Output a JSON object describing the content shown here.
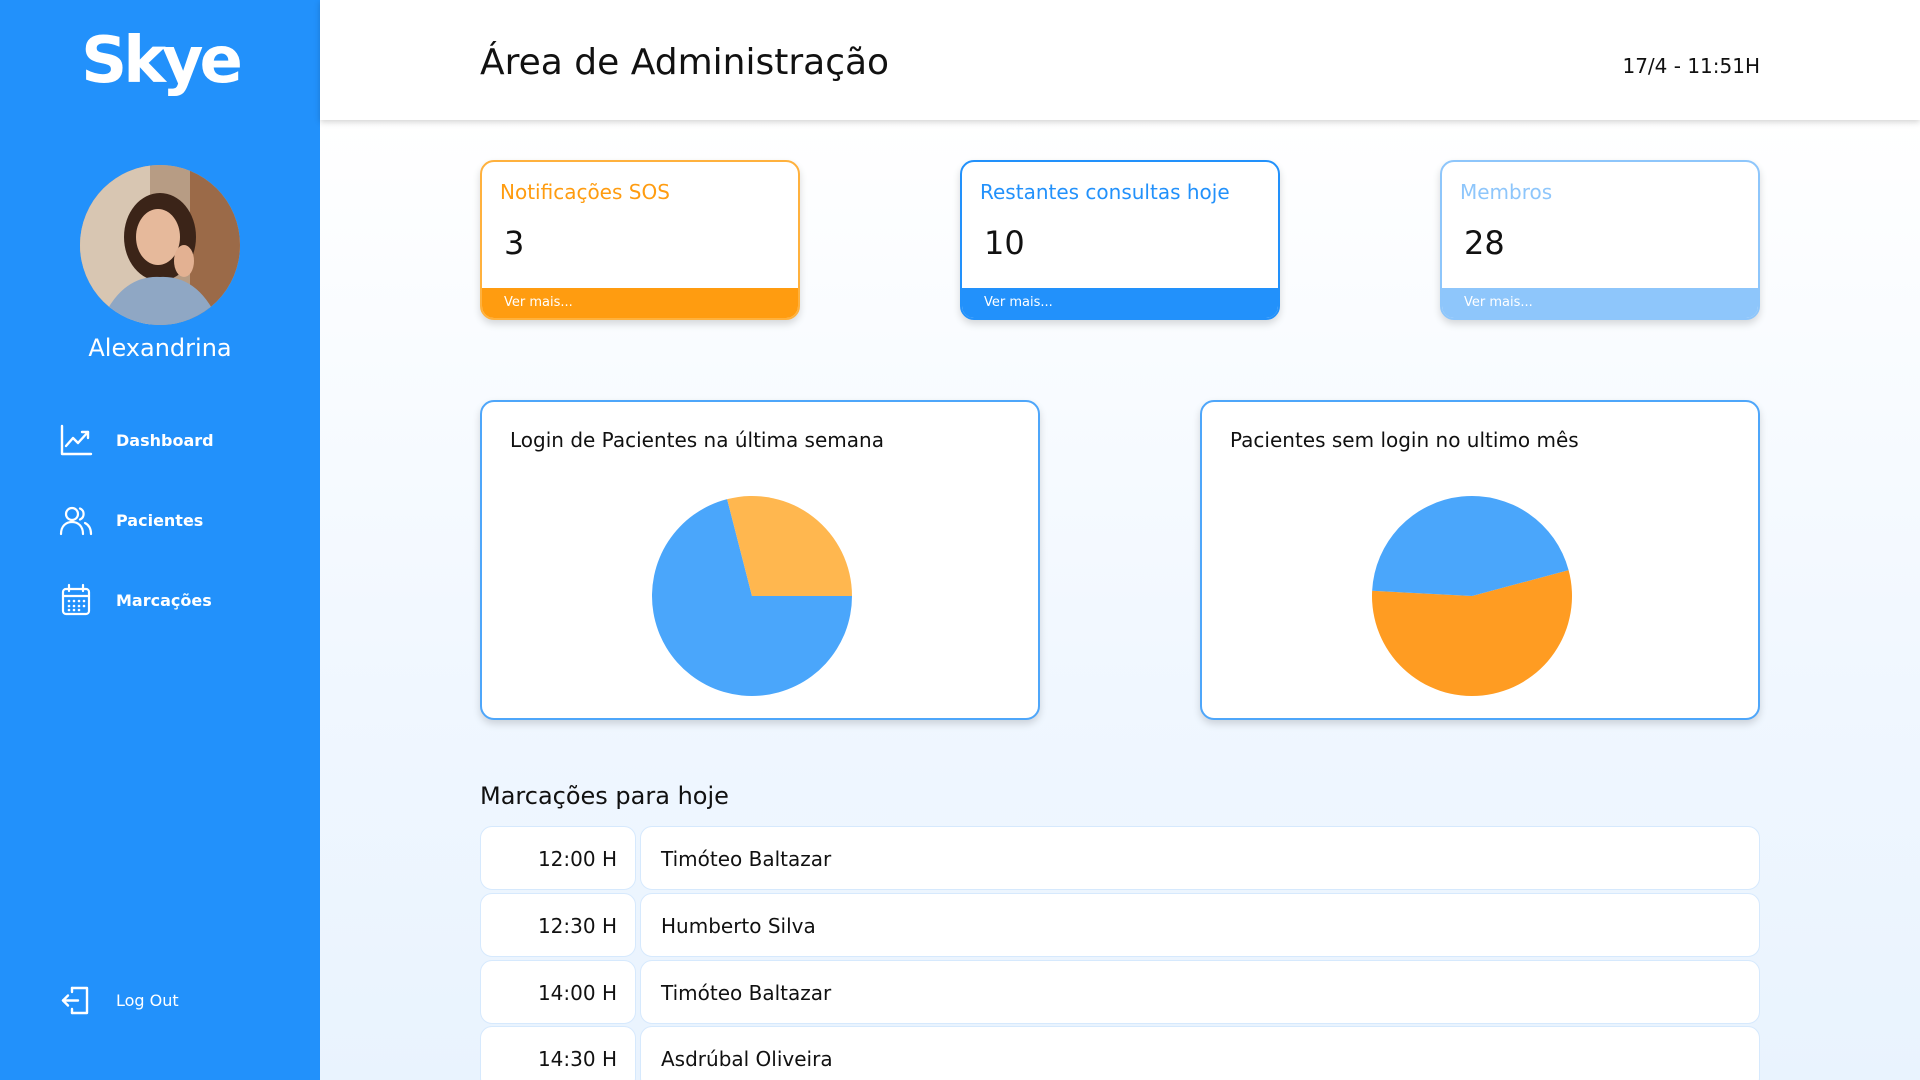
{
  "app": {
    "logo": "Skye"
  },
  "user": {
    "name": "Alexandrina"
  },
  "sidebar": {
    "items": [
      {
        "label": "Dashboard",
        "icon": "chart-line-icon"
      },
      {
        "label": "Pacientes",
        "icon": "users-icon"
      },
      {
        "label": "Marcações",
        "icon": "calendar-icon"
      }
    ],
    "logout": {
      "label": "Log Out",
      "icon": "logout-icon"
    }
  },
  "header": {
    "title": "Área de Administração",
    "datetime": "17/4 - 11:51H"
  },
  "stats": [
    {
      "label": "Notificações SOS",
      "value": "3",
      "more": "Ver mais...",
      "color": "#ff9c10"
    },
    {
      "label": "Restantes consultas hoje",
      "value": "10",
      "more": "Ver mais...",
      "color": "#2291fb"
    },
    {
      "label": "Membros",
      "value": "28",
      "more": "Ver mais...",
      "color": "#8ec6fb"
    }
  ],
  "colors": {
    "sidebar": "#2291fb",
    "orange": "#ff9c10",
    "light_orange": "#ffb74f",
    "pie_blue": "#4aa6fb"
  },
  "chart_data": [
    {
      "type": "pie",
      "title": "Login de Pacientes na última semana",
      "slices": [
        {
          "value": 71,
          "color": "#4aa6fb"
        },
        {
          "value": 29,
          "color": "#ffb74f"
        }
      ]
    },
    {
      "type": "pie",
      "title": "Pacientes sem login no ultimo mês",
      "slices": [
        {
          "value": 55,
          "color": "#ff9c22"
        },
        {
          "value": 45,
          "color": "#4aa6fb"
        }
      ]
    }
  ],
  "appointments": {
    "title": "Marcações para hoje",
    "items": [
      {
        "time": "12:00 H",
        "name": "Timóteo Baltazar"
      },
      {
        "time": "12:30 H",
        "name": "Humberto Silva"
      },
      {
        "time": "14:00 H",
        "name": "Timóteo Baltazar"
      },
      {
        "time": "14:30 H",
        "name": "Asdrúbal Oliveira"
      }
    ]
  }
}
